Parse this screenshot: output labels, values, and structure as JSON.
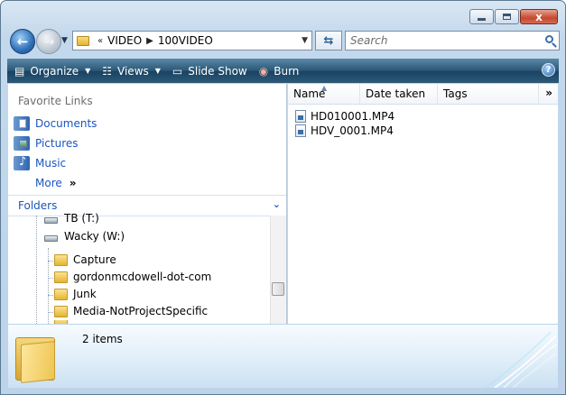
{
  "titlebar": {
    "minimize_label": "",
    "maximize_label": "",
    "close_label": "x"
  },
  "address": {
    "overflow": "«",
    "crumbs": [
      "VIDEO",
      "100VIDEO"
    ]
  },
  "search": {
    "placeholder": "Search"
  },
  "toolbar": {
    "organize": "Organize",
    "views": "Views",
    "slideshow": "Slide Show",
    "burn": "Burn",
    "help": "?"
  },
  "favorites": {
    "title": "Favorite Links",
    "items": [
      "Documents",
      "Pictures",
      "Music"
    ],
    "more": "More",
    "more_chevron": "»"
  },
  "folders": {
    "title": "Folders",
    "tree": [
      {
        "label": "TB (T:)",
        "type": "drive"
      },
      {
        "label": "Wacky (W:)",
        "type": "drive"
      },
      {
        "label": "Capture",
        "type": "folder"
      },
      {
        "label": "gordonmcdowell-dot-com",
        "type": "folder"
      },
      {
        "label": "Junk",
        "type": "folder"
      },
      {
        "label": "Media-NotProjectSpecific",
        "type": "folder"
      }
    ]
  },
  "columns": {
    "name": "Name",
    "date_taken": "Date taken",
    "tags": "Tags",
    "more": "»"
  },
  "files": [
    "HD010001.MP4",
    "HDV_0001.MP4"
  ],
  "details": {
    "count": "2 items"
  },
  "colors": {
    "link": "#1a55c0",
    "command_bar": "#2a5776",
    "close_button": "#c4492f"
  }
}
